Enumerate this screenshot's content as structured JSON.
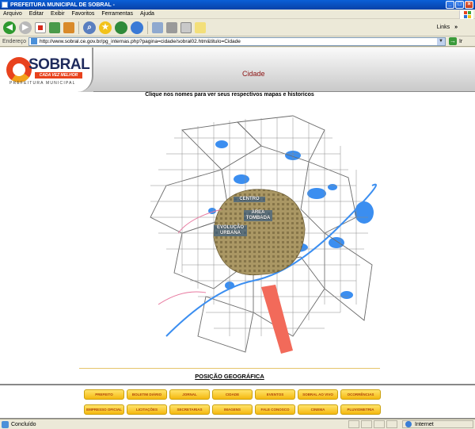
{
  "window": {
    "title": "PREFEITURA MUNICIPAL DE SOBRAL -",
    "controls": [
      "_",
      "□",
      "×"
    ]
  },
  "menu": {
    "items": [
      "Arquivo",
      "Editar",
      "Exibir",
      "Favoritos",
      "Ferramentas",
      "Ajuda"
    ]
  },
  "toolbar": {
    "links_label": "Links"
  },
  "address": {
    "label": "Endereço",
    "url": "http://www.sobral.ce.gov.br/pg_internas.php?pagina=cidade/sobral02.htm&titulo=Cidade",
    "go_label": "Ir"
  },
  "page": {
    "logo_name": "SOBRAL",
    "logo_tagline": "CADA VEZ MELHOR",
    "logo_subtitle": "PREFEITURA MUNICIPAL",
    "heading": "Cidade",
    "instruction": "Clique nos nomes para ver seus respectivos mapas e historicos",
    "map_labels": [
      "CENTRO",
      "ÁREA TOMBADA",
      "EVOLUÇÃO URBANA"
    ],
    "geo_title": "POSIÇÃO GEOGRÁFICA"
  },
  "nav": {
    "row1": [
      "PREFEITO",
      "BOLETIM DIÁRIO",
      "JORNAL",
      "CIDADE",
      "EVENTOS",
      "SOBRAL AO VIVO",
      "OCORRÊNCIAS"
    ],
    "row2": [
      "EMPRESSO OFICIAL",
      "LICITAÇÕES",
      "SECRETARIAS",
      "IMAGENS",
      "FALE CONOSCO",
      "CINEMA",
      "PLUVIOMETRIA"
    ]
  },
  "status": {
    "text": "Concluído",
    "zone": "Internet"
  },
  "colors": {
    "heading": "#8b1111",
    "button_fill": "#f5b80f",
    "button_text": "#b0450a",
    "logo_red": "#e8421d"
  }
}
